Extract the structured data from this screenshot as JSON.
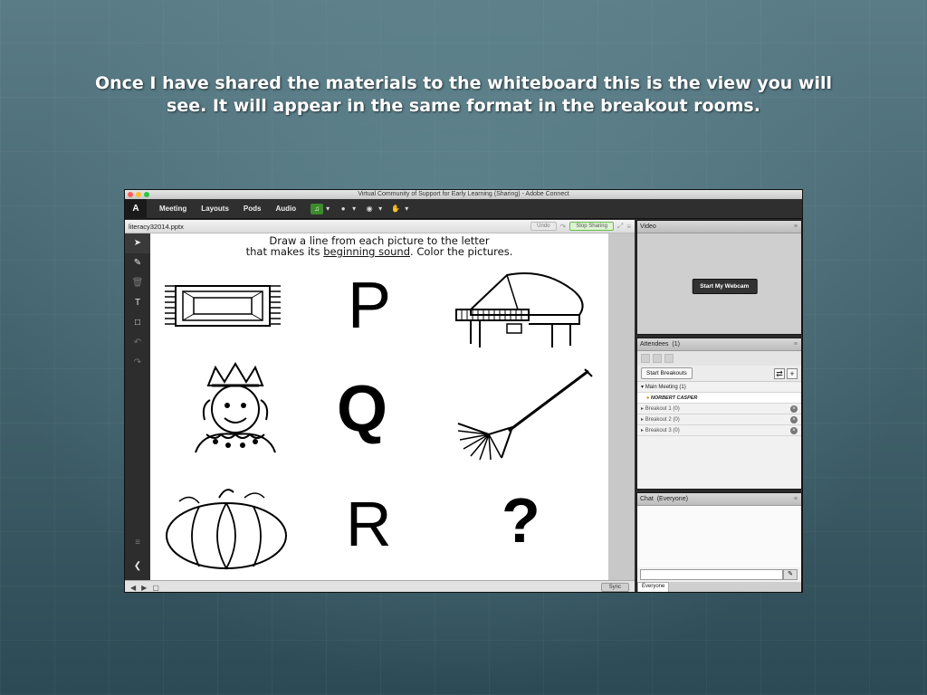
{
  "slide": {
    "title": "Once I have shared the materials to the whiteboard this is the view you will see.  It will appear in the same format in the breakout rooms."
  },
  "window": {
    "title": "Virtual Community of Support for Early Learning (Sharing) - Adobe Connect",
    "logo": "Adobe"
  },
  "menu": {
    "items": [
      "Meeting",
      "Layouts",
      "Pods",
      "Audio"
    ]
  },
  "share_pod": {
    "file_name": "literacy32014.pptx",
    "undo_label": "Undo",
    "stop_label": "Stop Sharing",
    "sync_label": "Sync"
  },
  "worksheet": {
    "instruction_line1": "Draw a line from each picture to the letter",
    "instruction_pre": "that makes its ",
    "instruction_underlined": "beginning sound",
    "instruction_post": ".  Color the pictures.",
    "letters": [
      "P",
      "Q",
      "R"
    ],
    "mystery": "?"
  },
  "video_pod": {
    "title": "Video",
    "webcam_button": "Start My Webcam"
  },
  "attendees_pod": {
    "title": "Attendees",
    "count": "(1)",
    "start_breakouts": "Start Breakouts",
    "main_meeting": "Main Meeting (1)",
    "user": "NORBERT CASPER",
    "breakouts": [
      "Breakout 1 (0)",
      "Breakout 2 (0)",
      "Breakout 3 (0)"
    ]
  },
  "chat_pod": {
    "title": "Chat",
    "scope": "(Everyone)",
    "tab": "Everyone"
  }
}
